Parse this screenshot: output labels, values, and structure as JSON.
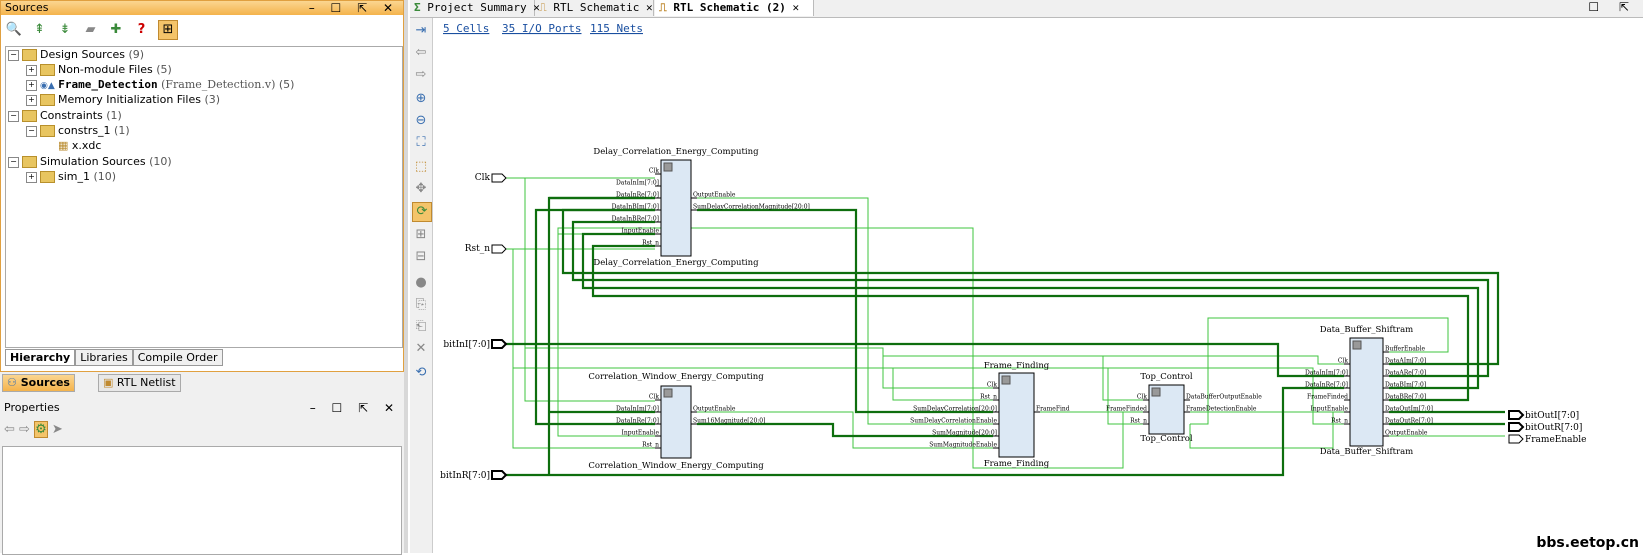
{
  "left_panel": {
    "sources_title": "Sources",
    "tree": [
      {
        "label": "Design Sources",
        "count": "(9)"
      },
      {
        "label": "Non-module Files",
        "count": "(5)"
      },
      {
        "label": "Frame_Detection",
        "sub": "(Frame_Detection.v)",
        "count": "(5)"
      },
      {
        "label": "Memory Initialization Files",
        "count": "(3)"
      },
      {
        "label": "Constraints",
        "count": "(1)"
      },
      {
        "label": "constrs_1",
        "count": "(1)"
      },
      {
        "label": "x.xdc",
        "count": ""
      },
      {
        "label": "Simulation Sources",
        "count": "(10)"
      },
      {
        "label": "sim_1",
        "count": "(10)"
      }
    ],
    "bottom_tabs": [
      "Hierarchy",
      "Libraries",
      "Compile Order"
    ],
    "view_tabs": [
      "Sources",
      "RTL Netlist"
    ],
    "properties_title": "Properties"
  },
  "editor": {
    "tabs": [
      "Project Summary",
      "RTL Schematic",
      "RTL Schematic (2)"
    ],
    "summary_links": [
      "5 Cells",
      "35 I/O Ports",
      "115 Nets"
    ]
  },
  "schematic": {
    "ports_in": [
      "Clk",
      "Rst_n",
      "bitInI[7:0]",
      "bitInR[7:0]"
    ],
    "ports_out": [
      "bitOutI[7:0]",
      "bitOutR[7:0]",
      "FrameEnable"
    ],
    "cells": {
      "dcec": {
        "name": "Delay_Correlation_Energy_Computing",
        "inst": "Delay_Correlation_Energy_Computing",
        "inputs": [
          "Clk",
          "DataInIm[7:0]",
          "DataInRe[7:0]",
          "DataInBIm[7:0]",
          "DataInBRe[7:0]",
          "InputEnable",
          "Rst_n"
        ],
        "outputs": [
          "OutputEnable",
          "SumDelayCorrelationMagnitude[20:0]"
        ]
      },
      "cwec": {
        "name": "Correlation_Window_Energy_Computing",
        "inst": "Correlation_Window_Energy_Computing",
        "inputs": [
          "Clk",
          "DataInIm[7:0]",
          "DataInRe[7:0]",
          "InputEnable",
          "Rst_n"
        ],
        "outputs": [
          "OutputEnable",
          "Sum16Magnitude[20:0]"
        ]
      },
      "ff": {
        "name": "Frame_Finding",
        "inst": "Frame_Finding",
        "inputs": [
          "Clk",
          "Rst_n",
          "SumDelayCorrelation[20:0]",
          "SumDelayCorrelationEnable",
          "SumMagnitude[20:0]",
          "SumMagnitudeEnable"
        ],
        "outputs": [
          "FrameFind"
        ]
      },
      "tc": {
        "name": "Top_Control",
        "inst": "Top_Control",
        "inputs": [
          "Clk",
          "FrameFinded",
          "Rst_n"
        ],
        "outputs": [
          "DataBufferOutputEnable",
          "FrameDetectionEnable"
        ]
      },
      "dbs": {
        "name": "Data_Buffer_Shiftram",
        "inst": "Data_Buffer_Shiftram",
        "inputs": [
          "Clk",
          "DataInIm[7:0]",
          "DataInRe[7:0]",
          "FrameFinded",
          "InputEnable",
          "Rst_n"
        ],
        "outputs": [
          "BufferEnable",
          "DataAIm[7:0]",
          "DataARe[7:0]",
          "DataBIm[7:0]",
          "DataBRe[7:0]",
          "DataOutIm[7:0]",
          "DataOutRe[7:0]",
          "OutputEnable"
        ]
      }
    }
  },
  "watermark": "bbs.eetop.cn"
}
